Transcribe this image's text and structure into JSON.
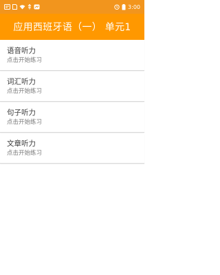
{
  "status_bar": {
    "time": "3:00",
    "icons": [
      "notification-icon",
      "sim-icon",
      "wifi-icon",
      "usb-icon",
      "app-icon",
      "alarm-icon",
      "battery-icon"
    ]
  },
  "app_bar": {
    "title": "应用西班牙语（一） 单元1",
    "background": "#ff9800"
  },
  "list": {
    "items": [
      {
        "title": "语音听力",
        "subtitle": "点击开始练习"
      },
      {
        "title": "词汇听力",
        "subtitle": "点击开始练习"
      },
      {
        "title": "句子听力",
        "subtitle": "点击开始练习"
      },
      {
        "title": "文章听力",
        "subtitle": "点击开始练习"
      }
    ]
  }
}
